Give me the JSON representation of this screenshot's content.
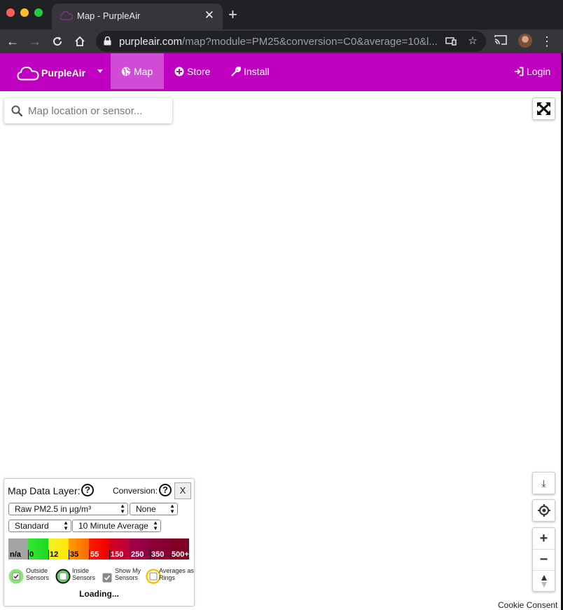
{
  "browser": {
    "tab_title": "Map - PurpleAir",
    "url_host": "purpleair.com",
    "url_path": "/map?module=PM25&conversion=C0&average=10&l..."
  },
  "nav": {
    "brand": "PurpleAir",
    "map": "Map",
    "store": "Store",
    "install": "Install",
    "login": "Login"
  },
  "search": {
    "placeholder": "Map location or sensor..."
  },
  "panel": {
    "map_data_layer": "Map Data Layer:",
    "conversion": "Conversion:",
    "help": "?",
    "close": "X",
    "data_layer_value": "Raw PM2.5 in µg/m³",
    "conversion_value": "None",
    "scheme_value": "Standard",
    "average_value": "10 Minute Average",
    "scale_labels": [
      "n/a",
      "0",
      "12",
      "35",
      "55",
      "150",
      "250",
      "350",
      "500+"
    ],
    "legend": {
      "outside": "Outside Sensors",
      "inside": "Inside Sensors",
      "show_my": "Show My Sensors",
      "rings": "Averages as Rings"
    },
    "loading": "Loading..."
  },
  "cookie": "Cookie Consent",
  "colors": {
    "brand": "#c000c0",
    "brand_active": "#d24bd6"
  }
}
